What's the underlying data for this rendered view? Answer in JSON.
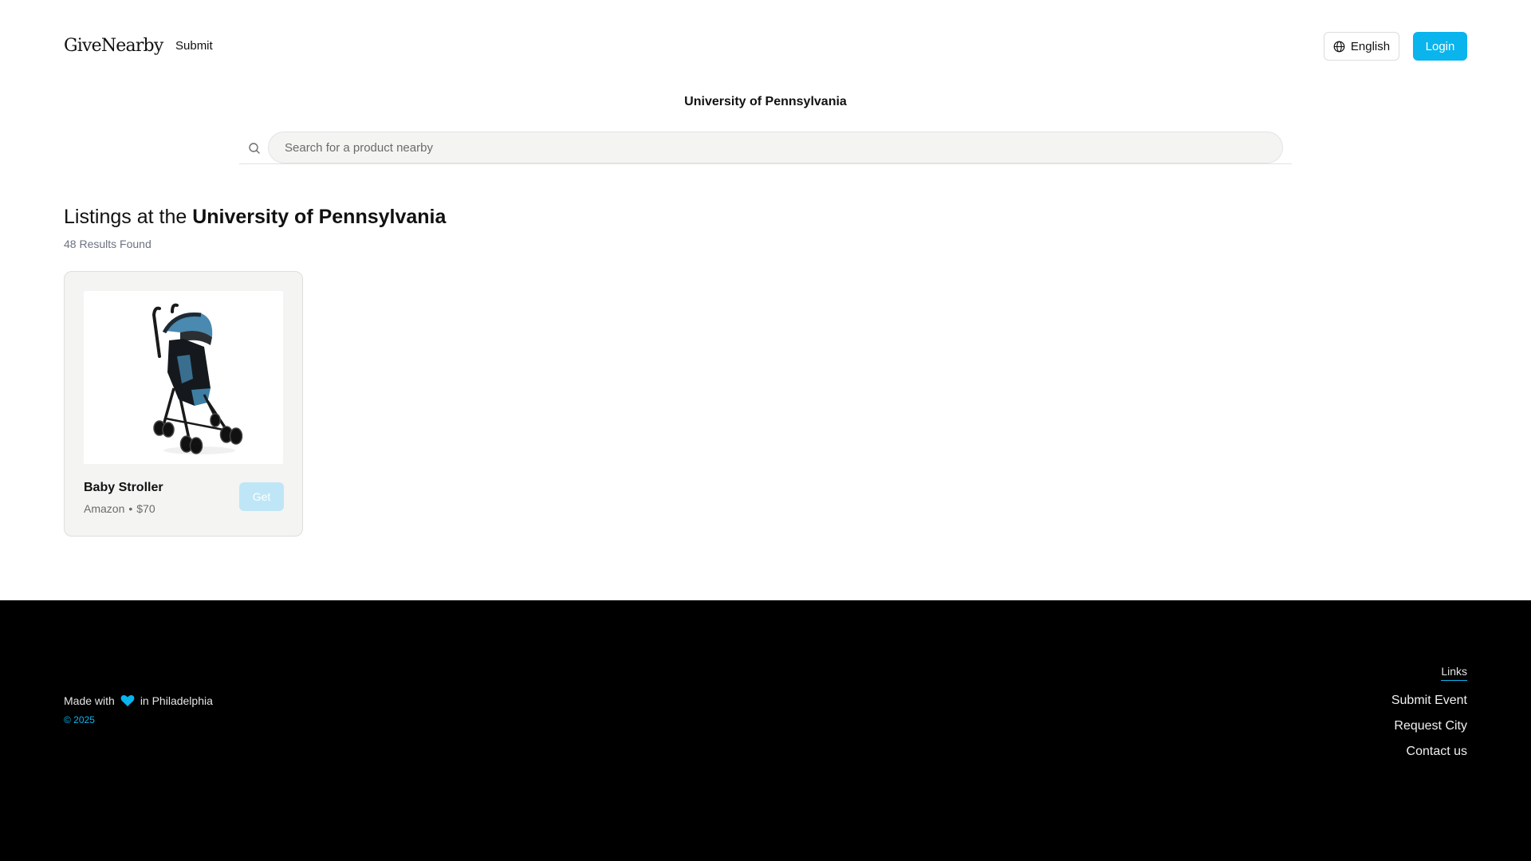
{
  "header": {
    "logo": "GiveNearby",
    "nav_submit": "Submit",
    "language_label": "English",
    "login_label": "Login"
  },
  "location": {
    "title": "University of Pennsylvania"
  },
  "search": {
    "placeholder": "Search for a product nearby",
    "value": ""
  },
  "listings": {
    "heading_prefix": "Listings at the",
    "heading_location": "University of Pennsylvania",
    "results_count": "48 Results Found",
    "items": [
      {
        "title": "Baby Stroller",
        "vendor": "Amazon",
        "separator": "•",
        "price": "$70",
        "action_label": "Get",
        "image": "baby-stroller-image"
      }
    ]
  },
  "footer": {
    "made_with_prefix": "Made with",
    "made_with_suffix": "in Philadelphia",
    "copyright": "© 2025",
    "links_heading": "Links",
    "links": [
      "Submit Event",
      "Request City",
      "Contact us"
    ]
  },
  "colors": {
    "accent": "#0ab4ec",
    "disabled_button": "#bfe6f6",
    "footer_bg": "#000000",
    "card_bg": "#f4f4f3"
  },
  "icons": {
    "language": "globe-icon",
    "search": "search-icon",
    "heart": "heart-icon"
  }
}
